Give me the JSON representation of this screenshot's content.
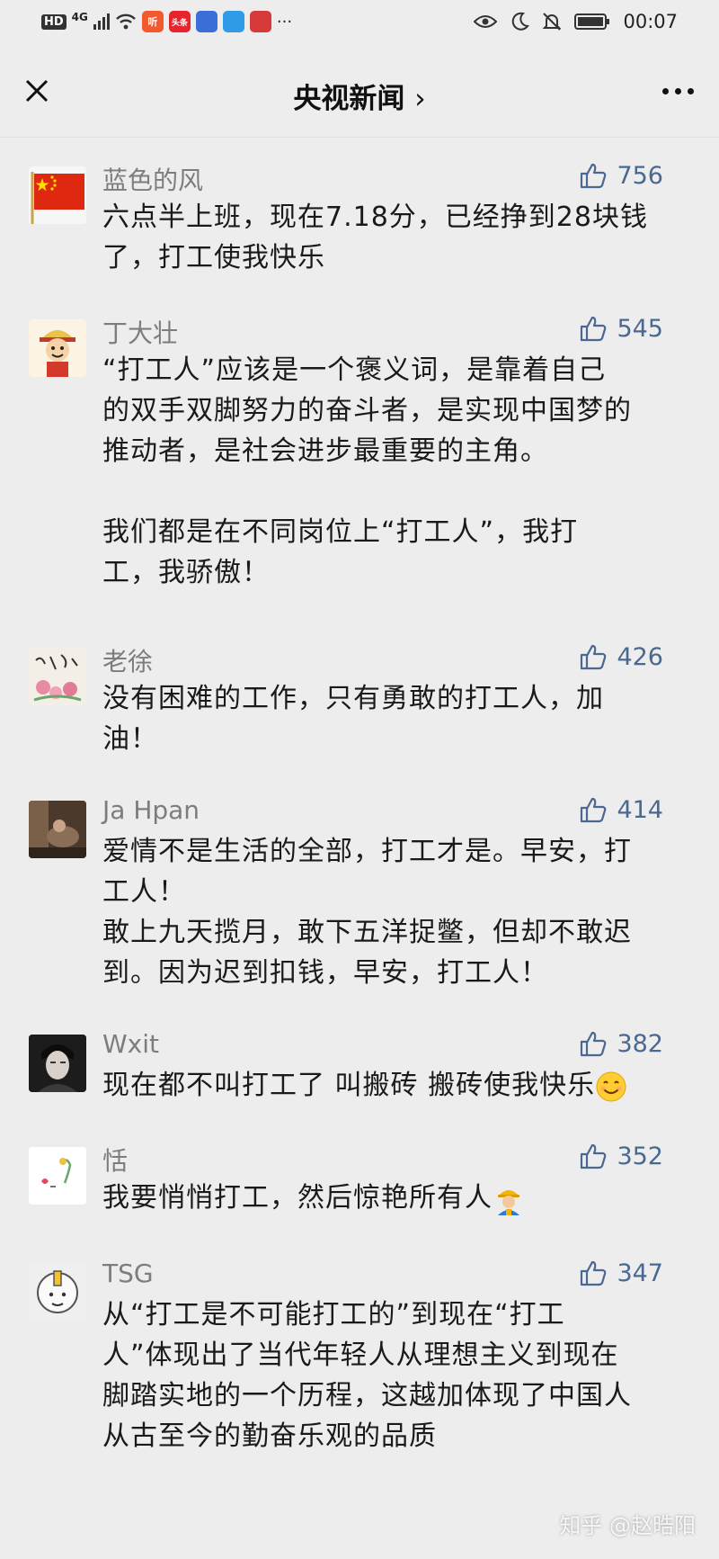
{
  "status_bar": {
    "left_badges": [
      "HD",
      "4G"
    ],
    "app_icon_labels": [
      "听",
      "头条"
    ],
    "ellipsis": "···",
    "time": "00:07",
    "icons": [
      "eye-icon",
      "moon-icon",
      "bell-off-icon",
      "battery-icon"
    ]
  },
  "nav": {
    "title": "央视新闻",
    "chevron": "›",
    "close_icon": "close-icon",
    "more_icon": "more-icon"
  },
  "comments": [
    {
      "name": "蓝色的风",
      "likes": "756",
      "lines": [
        "六点半上班，现在7.18分，已经挣到28块钱",
        "了，打工使我快乐"
      ]
    },
    {
      "name": "丁大壮",
      "likes": "545",
      "lines": [
        "“打工人”应该是一个褒义词，是靠着自己",
        "的双手双脚努力的奋斗者，是实现中国梦的",
        "推动者，是社会进步最重要的主角。",
        "",
        "我们都是在不同岗位上“打工人”，我打",
        "工，我骄傲！"
      ]
    },
    {
      "name": "老徐",
      "likes": "426",
      "lines": [
        "没有困难的工作，只有勇敢的打工人，加",
        "油！"
      ]
    },
    {
      "name": "Ja Hpan",
      "likes": "414",
      "lines": [
        "爱情不是生活的全部，打工才是。早安，打",
        "工人！",
        "敢上九天揽月，敢下五洋捉鳖，但却不敢迟",
        "到。因为迟到扣钱，早安，打工人！"
      ]
    },
    {
      "name": "Wxit",
      "likes": "382",
      "lines": [
        "现在都不叫打工了 叫搬砖 搬砖使我快乐"
      ],
      "emoji": "smile-emoji"
    },
    {
      "name": "恬",
      "likes": "352",
      "lines": [
        "我要悄悄打工，然后惊艳所有人"
      ],
      "emoji": "worker-emoji"
    },
    {
      "name": "TSG",
      "likes": "347",
      "lines": [
        "从“打工是不可能打工的”到现在“打工",
        "人”体现出了当代年轻人从理想主义到现在",
        "脚踏实地的一个历程，这越加体现了中国人",
        "从古至今的勤奋乐观的品质"
      ]
    }
  ],
  "watermark": "知乎 @赵晧阳",
  "colors": {
    "background": "#ededed",
    "name": "#7d7d7d",
    "like": "#4a6890",
    "text": "#1a1a1a"
  }
}
